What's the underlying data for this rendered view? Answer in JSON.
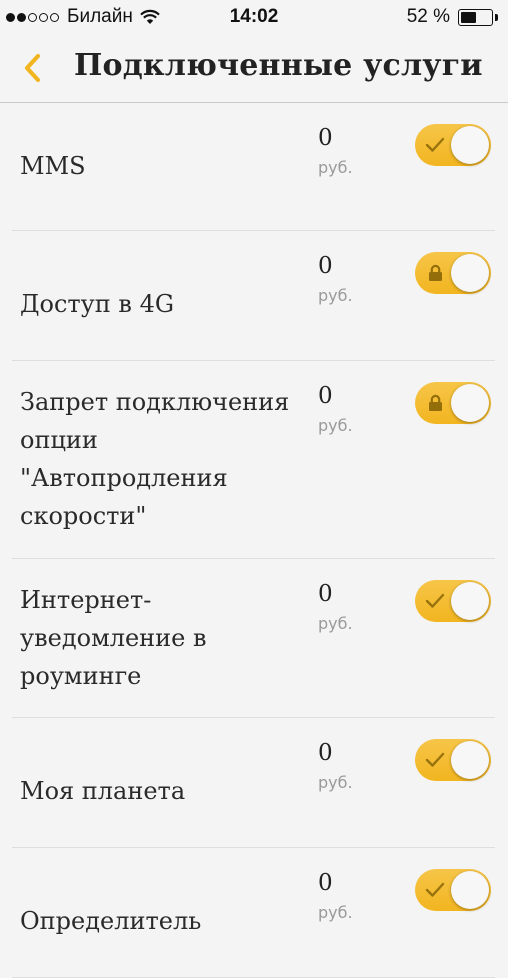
{
  "status_bar": {
    "carrier": "Билайн",
    "time": "14:02",
    "battery_text": "52 %",
    "signal_bars_full": 2,
    "signal_bars_total": 5,
    "battery_level": 0.52
  },
  "nav": {
    "back_icon": "chevron-left-icon",
    "title": "Подключенные услуги"
  },
  "colors": {
    "accent": "#f2b520",
    "back_chevron": "#f2b520",
    "background": "#f4f4f4"
  },
  "services": [
    {
      "name": "MMS",
      "price": "0",
      "unit": "руб.",
      "enabled": true,
      "locked": false,
      "toggle_icon": "check-icon"
    },
    {
      "name": "Доступ в 4G",
      "price": "0",
      "unit": "руб.",
      "enabled": true,
      "locked": true,
      "toggle_icon": "lock-icon"
    },
    {
      "name": "Запрет подключения опции \"Автопродления скорости\"",
      "price": "0",
      "unit": "руб.",
      "enabled": true,
      "locked": true,
      "toggle_icon": "lock-icon"
    },
    {
      "name": "Интернет-уведомление в роуминге",
      "price": "0",
      "unit": "руб.",
      "enabled": true,
      "locked": false,
      "toggle_icon": "check-icon"
    },
    {
      "name": "Моя планета",
      "price": "0",
      "unit": "руб.",
      "enabled": true,
      "locked": false,
      "toggle_icon": "check-icon"
    },
    {
      "name": "Определитель",
      "price": "0",
      "unit": "руб.",
      "enabled": true,
      "locked": false,
      "toggle_icon": "check-icon"
    }
  ]
}
